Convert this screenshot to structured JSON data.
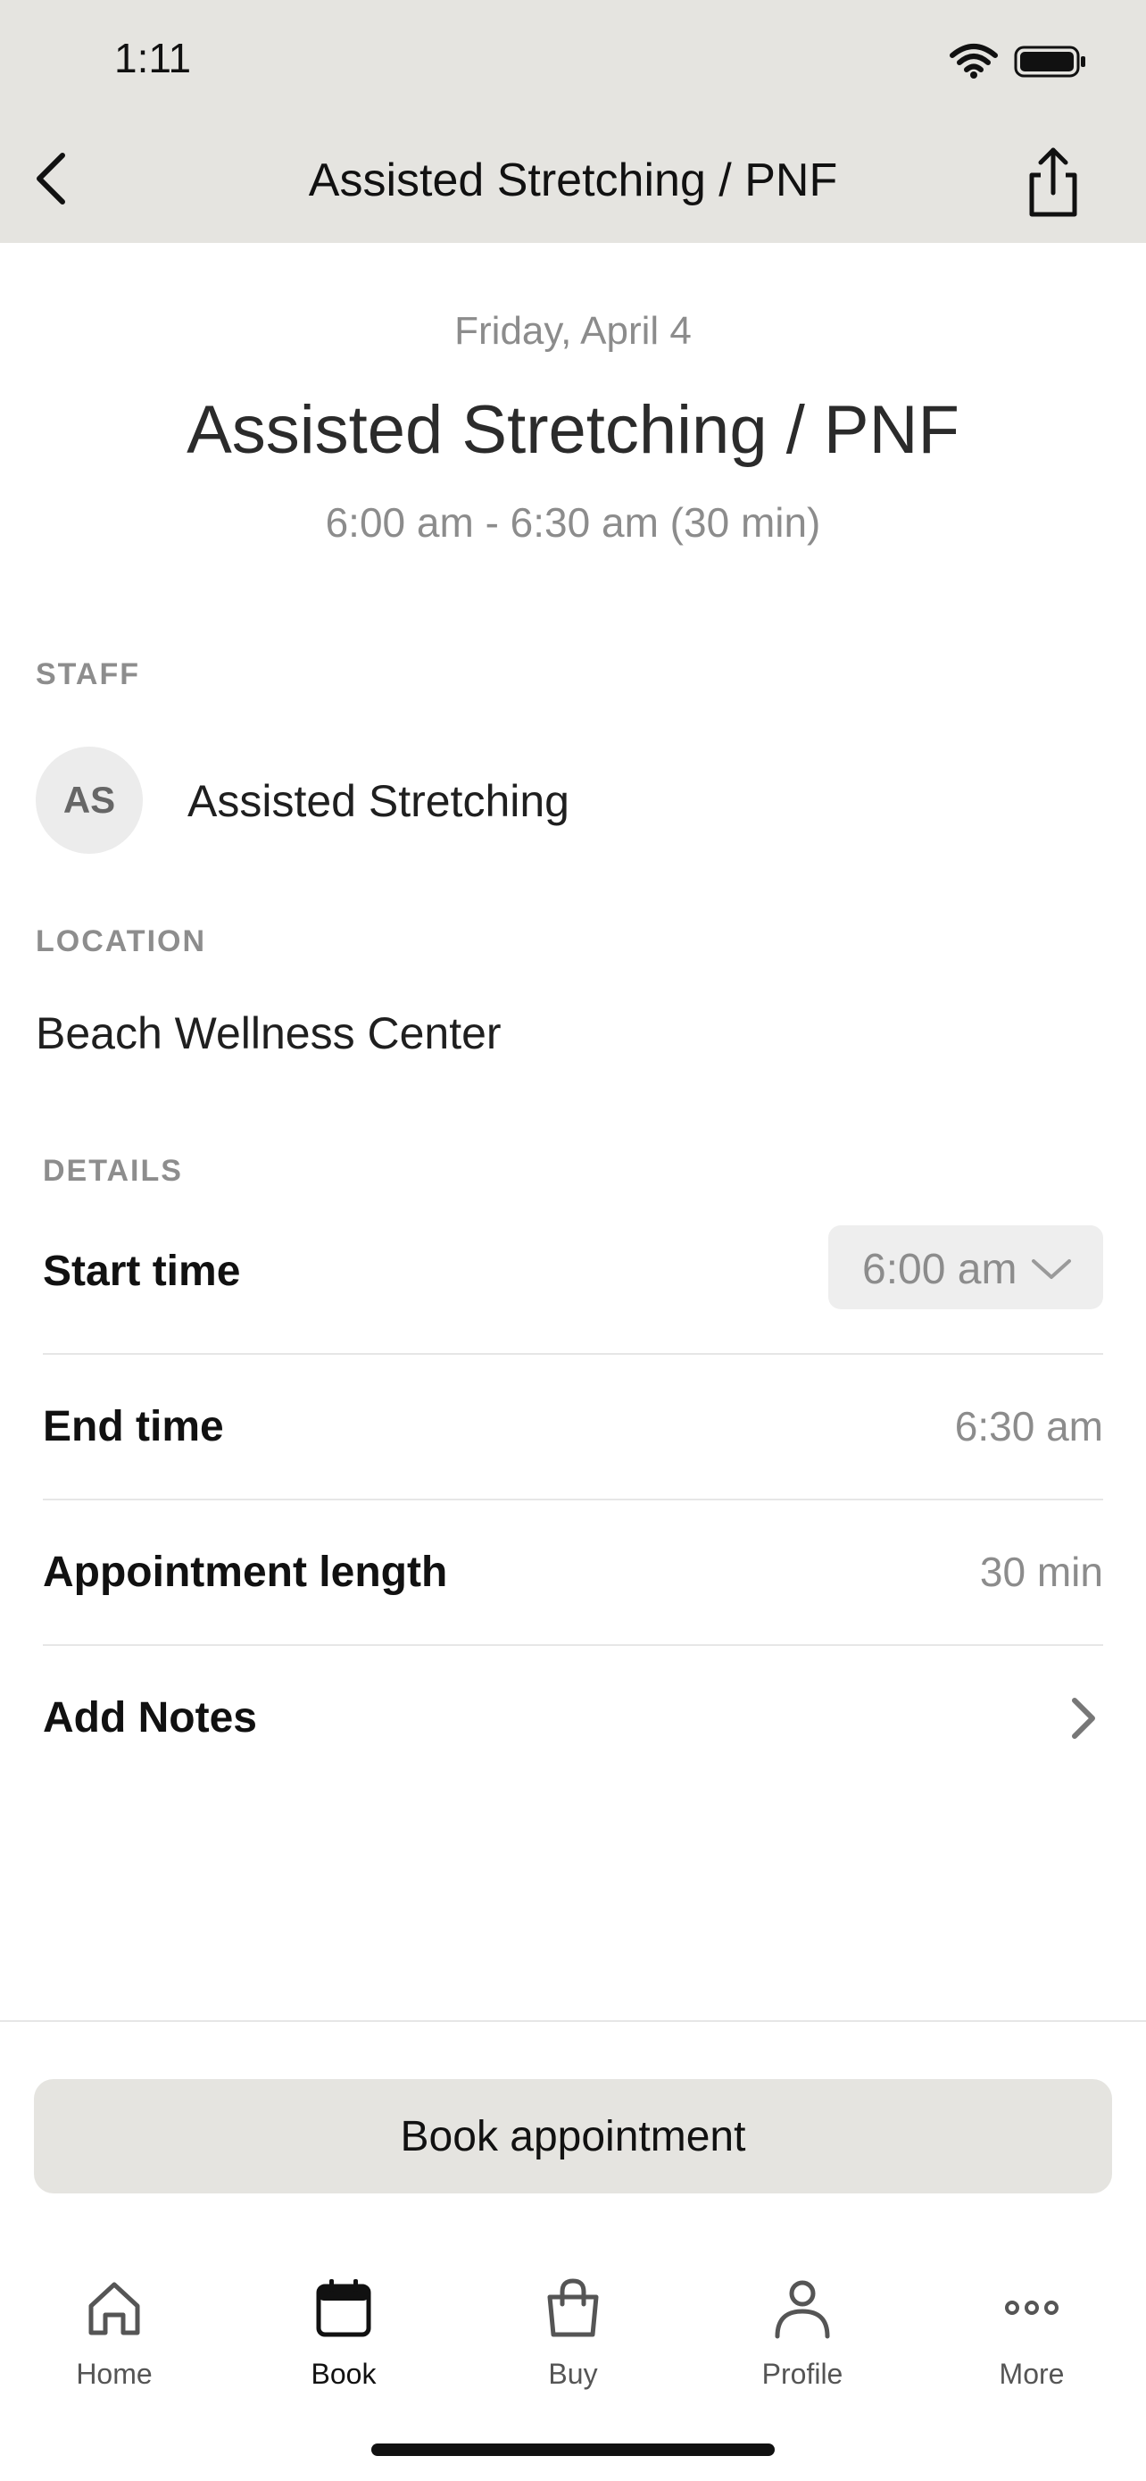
{
  "status_bar": {
    "time": "1:11"
  },
  "nav": {
    "title": "Assisted Stretching / PNF"
  },
  "appointment": {
    "date": "Friday, April 4",
    "title": "Assisted Stretching / PNF",
    "time_range": "6:00 am - 6:30 am (30 min)"
  },
  "staff": {
    "section_label": "STAFF",
    "initials": "AS",
    "name": "Assisted Stretching"
  },
  "location": {
    "section_label": "LOCATION",
    "name": "Beach Wellness Center"
  },
  "details": {
    "section_label": "DETAILS",
    "start_time_label": "Start time",
    "start_time_value": "6:00 am",
    "end_time_label": "End time",
    "end_time_value": "6:30 am",
    "length_label": "Appointment length",
    "length_value": "30 min",
    "notes_label": "Add Notes"
  },
  "actions": {
    "book_label": "Book appointment"
  },
  "tabbar": {
    "items": [
      {
        "label": "Home",
        "icon": "home-icon"
      },
      {
        "label": "Book",
        "icon": "calendar-icon",
        "active": true
      },
      {
        "label": "Buy",
        "icon": "shopping-bag-icon"
      },
      {
        "label": "Profile",
        "icon": "person-icon"
      },
      {
        "label": "More",
        "icon": "more-dots-icon"
      }
    ]
  }
}
